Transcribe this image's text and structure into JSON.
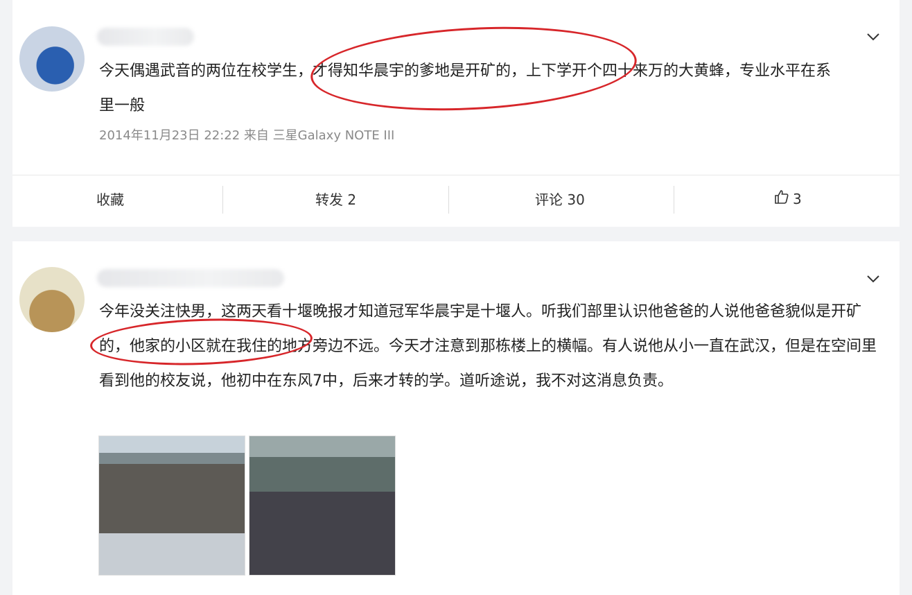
{
  "post1": {
    "text": "今天偶遇武音的两位在校学生，才得知华晨宇的爹地是开矿的，上下学开个四十来万的大黄蜂，专业水平在系里一般",
    "meta": "2014年11月23日 22:22 来自 三星Galaxy NOTE III",
    "actions": {
      "favorite": "收藏",
      "repost": "转发 2",
      "comment": "评论 30",
      "like_count": "3"
    }
  },
  "post2": {
    "text": "今年没关注快男，这两天看十堰晚报才知道冠军华晨宇是十堰人。听我们部里认识他爸爸的人说他爸爸貌似是开矿的，他家的小区就在我住的地方旁边不远。今天才注意到那栋楼上的横幅。有人说他从小一直在武汉，但是在空间里看到他的校友说，他初中在东风7中，后来才转的学。道听途说，我不对这消息负责。"
  },
  "colors": {
    "highlight_ring": "#d7262a",
    "background": "#f2f3f5",
    "card": "#ffffff"
  },
  "icons": [
    "chevron-down-icon",
    "thumbs-up-icon"
  ]
}
